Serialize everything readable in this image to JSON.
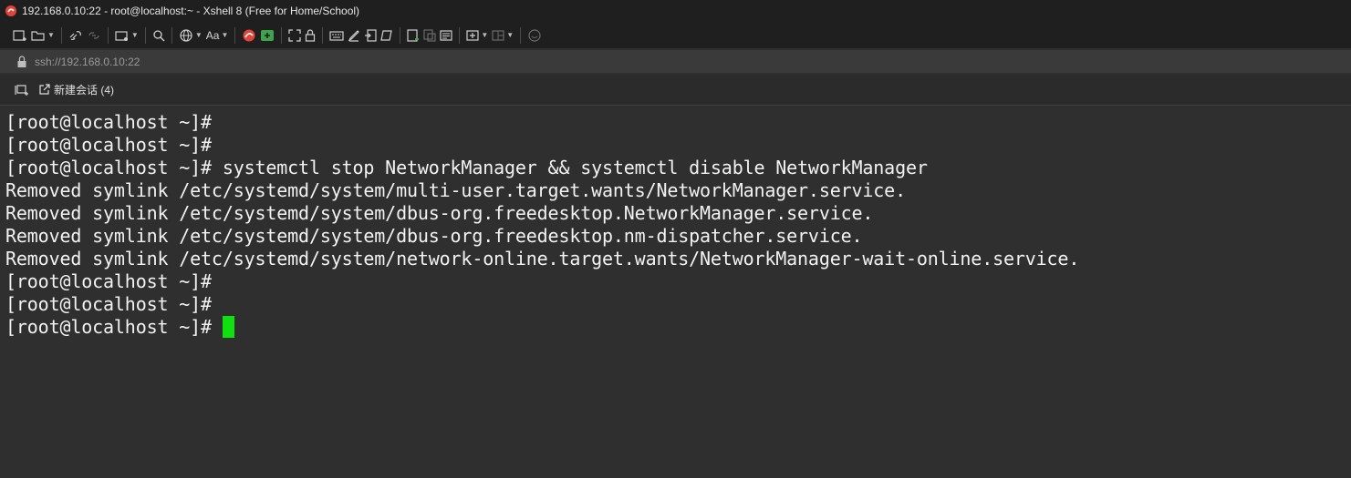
{
  "window": {
    "title": "192.168.0.10:22 - root@localhost:~ - Xshell 8 (Free for Home/School)"
  },
  "toolbar": {
    "font_button_label": "Aa",
    "icons": [
      "new-session-icon",
      "open-folder-icon",
      "reconnect-icon",
      "disconnect-icon",
      "new-tab-icon",
      "search-icon",
      "globe-icon",
      "font-icon",
      "xshell-icon",
      "xftp-icon",
      "fullscreen-icon",
      "lock-icon",
      "keyboard-icon",
      "compose-icon",
      "log-icon",
      "script-icon",
      "new-file-icon",
      "copy-file-icon",
      "notes-icon",
      "add-tab-icon",
      "layout-icon",
      "chat-icon"
    ]
  },
  "address": {
    "url": "ssh://192.168.0.10:22"
  },
  "tabs": {
    "session_tab_label": "新建会话 (4)"
  },
  "terminal": {
    "lines": [
      "[root@localhost ~]#",
      "[root@localhost ~]#",
      "[root@localhost ~]# systemctl stop NetworkManager && systemctl disable NetworkManager",
      "Removed symlink /etc/systemd/system/multi-user.target.wants/NetworkManager.service.",
      "Removed symlink /etc/systemd/system/dbus-org.freedesktop.NetworkManager.service.",
      "Removed symlink /etc/systemd/system/dbus-org.freedesktop.nm-dispatcher.service.",
      "Removed symlink /etc/systemd/system/network-online.target.wants/NetworkManager-wait-online.service.",
      "[root@localhost ~]#",
      "[root@localhost ~]#",
      "[root@localhost ~]# "
    ],
    "cursor_color": "#10e010"
  },
  "colors": {
    "app_icon": "#e0453a",
    "xftp_icon": "#3fa34d",
    "background": "#2f2f2f",
    "cursor": "#10e010"
  }
}
